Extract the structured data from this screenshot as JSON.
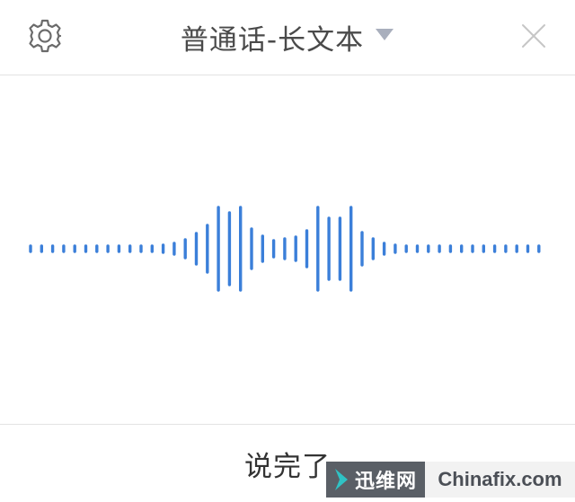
{
  "header": {
    "title": "普通话-长文本"
  },
  "icons": {
    "settings": "gear-icon",
    "dropdown": "caret-down-icon",
    "close": "close-icon"
  },
  "footer": {
    "done_label": "说完了"
  },
  "watermark": {
    "cn_text": "迅维网",
    "en_text": "Chinafix.com"
  },
  "colors": {
    "accent": "#3b7fd9",
    "icon_gray": "#6b6b6b",
    "close_gray": "#c6c6c6",
    "caret_gray": "#a9afbd"
  }
}
